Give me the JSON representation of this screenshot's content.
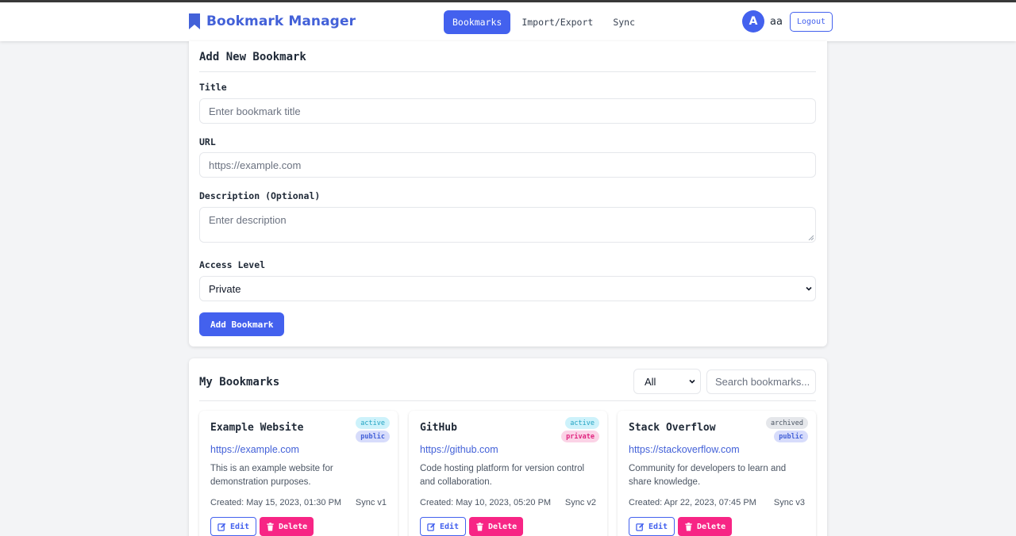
{
  "app": {
    "title": "Bookmark Manager"
  },
  "nav": {
    "items": [
      {
        "label": "Bookmarks",
        "active": true
      },
      {
        "label": "Import/Export",
        "active": false
      },
      {
        "label": "Sync",
        "active": false
      }
    ]
  },
  "user": {
    "avatar_initial": "A",
    "name": "aa",
    "logout_label": "Logout"
  },
  "form": {
    "heading": "Add New Bookmark",
    "title_label": "Title",
    "title_placeholder": "Enter bookmark title",
    "url_label": "URL",
    "url_placeholder": "https://example.com",
    "description_label": "Description (Optional)",
    "description_placeholder": "Enter description",
    "access_label": "Access Level",
    "access_value": "Private",
    "submit_label": "Add Bookmark"
  },
  "list": {
    "heading": "My Bookmarks",
    "filter_value": "All",
    "search_placeholder": "Search bookmarks...",
    "edit_label": "Edit",
    "delete_label": "Delete",
    "bookmarks": [
      {
        "title": "Example Website",
        "url": "https://example.com",
        "description": "This is an example website for demonstration purposes.",
        "created": "Created: May 15, 2023, 01:30 PM",
        "sync": "Sync v1",
        "status": "active",
        "access": "public"
      },
      {
        "title": "GitHub",
        "url": "https://github.com",
        "description": "Code hosting platform for version control and collaboration.",
        "created": "Created: May 10, 2023, 05:20 PM",
        "sync": "Sync v2",
        "status": "active",
        "access": "private"
      },
      {
        "title": "Stack Overflow",
        "url": "https://stackoverflow.com",
        "description": "Community for developers to learn and share knowledge.",
        "created": "Created: Apr 22, 2023, 07:45 PM",
        "sync": "Sync v3",
        "status": "archived",
        "access": "public"
      }
    ]
  },
  "colors": {
    "primary": "#4361ee",
    "danger": "#f72585",
    "background": "#f3f4f6"
  },
  "icons": {
    "brand": "bookmark-icon",
    "edit": "edit-icon",
    "delete": "trash-icon",
    "select": "chevron-down-icon"
  }
}
